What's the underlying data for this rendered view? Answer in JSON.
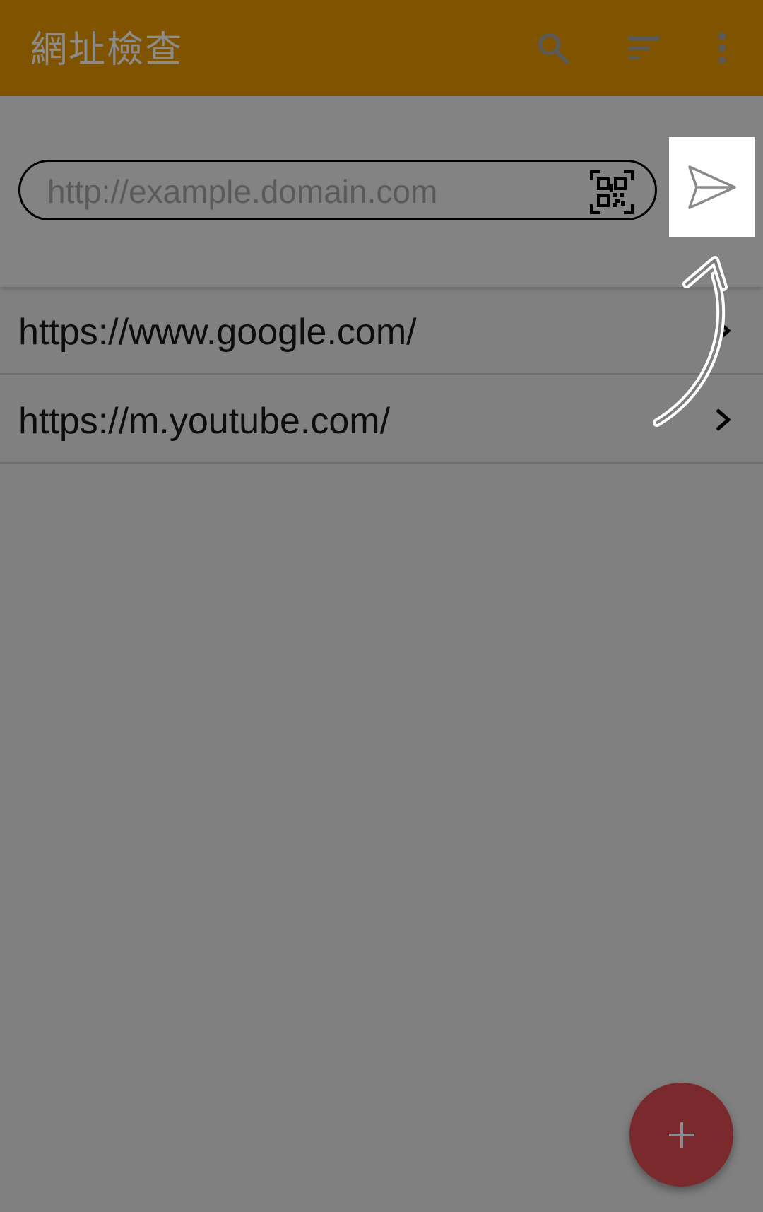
{
  "appbar": {
    "title": "網址檢查",
    "icons": [
      "search-icon",
      "sort-icon",
      "more-vert-icon"
    ]
  },
  "url_input": {
    "value": "",
    "placeholder": "http://example.domain.com",
    "scan_icon": "qr-code-scan-icon",
    "send_icon": "send-icon"
  },
  "history": [
    {
      "url": "https://www.google.com/"
    },
    {
      "url": "https://m.youtube.com/"
    }
  ],
  "fab": {
    "icon": "plus-icon"
  },
  "colors": {
    "appbar": "#7f5300",
    "background": "#808080",
    "fab": "#7a2a2c",
    "send_highlight": "#ffffff"
  }
}
